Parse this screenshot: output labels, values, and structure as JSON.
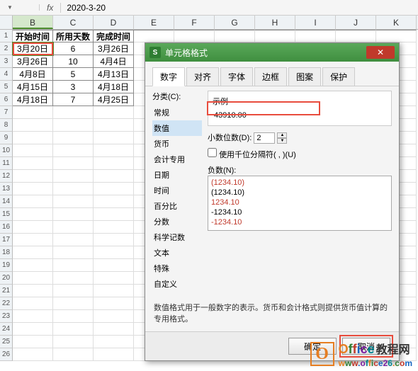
{
  "formula_bar": {
    "name_box": "",
    "fx": "fx",
    "formula": "2020-3-20"
  },
  "columns": [
    "B",
    "C",
    "D",
    "E",
    "F",
    "G",
    "H",
    "I",
    "J",
    "K"
  ],
  "selected_col": "B",
  "rows": [
    {
      "n": "1",
      "cells": [
        "开始时间",
        "所用天数",
        "完成时间"
      ],
      "header": true
    },
    {
      "n": "2",
      "cells": [
        "3月20日",
        "6",
        "3月26日"
      ],
      "sel": 0
    },
    {
      "n": "3",
      "cells": [
        "3月26日",
        "10",
        "4月4日"
      ]
    },
    {
      "n": "4",
      "cells": [
        "4月8日",
        "5",
        "4月13日"
      ]
    },
    {
      "n": "5",
      "cells": [
        "4月15日",
        "3",
        "4月18日"
      ]
    },
    {
      "n": "6",
      "cells": [
        "4月18日",
        "7",
        "4月25日"
      ]
    }
  ],
  "empty_rows": [
    "7",
    "8",
    "9",
    "10",
    "11",
    "12",
    "13",
    "14",
    "15",
    "16",
    "17",
    "18",
    "19",
    "20",
    "21",
    "22",
    "23",
    "24",
    "25",
    "26"
  ],
  "dialog": {
    "title": "单元格格式",
    "tabs": [
      "数字",
      "对齐",
      "字体",
      "边框",
      "图案",
      "保护"
    ],
    "active_tab": "数字",
    "category_label": "分类(C):",
    "categories": [
      "常规",
      "数值",
      "货币",
      "会计专用",
      "日期",
      "时间",
      "百分比",
      "分数",
      "科学记数",
      "文本",
      "特殊",
      "自定义"
    ],
    "selected_category": "数值",
    "example_label": "示例",
    "example_value": "43910.00",
    "decimal_label": "小数位数(D):",
    "decimal_value": "2",
    "thousands_label": "使用千位分隔符( , )(U)",
    "negative_label": "负数(N):",
    "negatives": [
      {
        "text": "(1234.10)",
        "red": true
      },
      {
        "text": "(1234.10)",
        "red": false
      },
      {
        "text": "1234.10",
        "red": true
      },
      {
        "text": "-1234.10",
        "red": false
      },
      {
        "text": "-1234.10",
        "red": true
      }
    ],
    "description": "数值格式用于一般数字的表示。货币和会计格式则提供货币值计算的专用格式。",
    "ok": "确定",
    "cancel": "取消"
  },
  "logo": {
    "brand": "Office",
    "suffix": "教程网",
    "url": "www.office26.com"
  }
}
